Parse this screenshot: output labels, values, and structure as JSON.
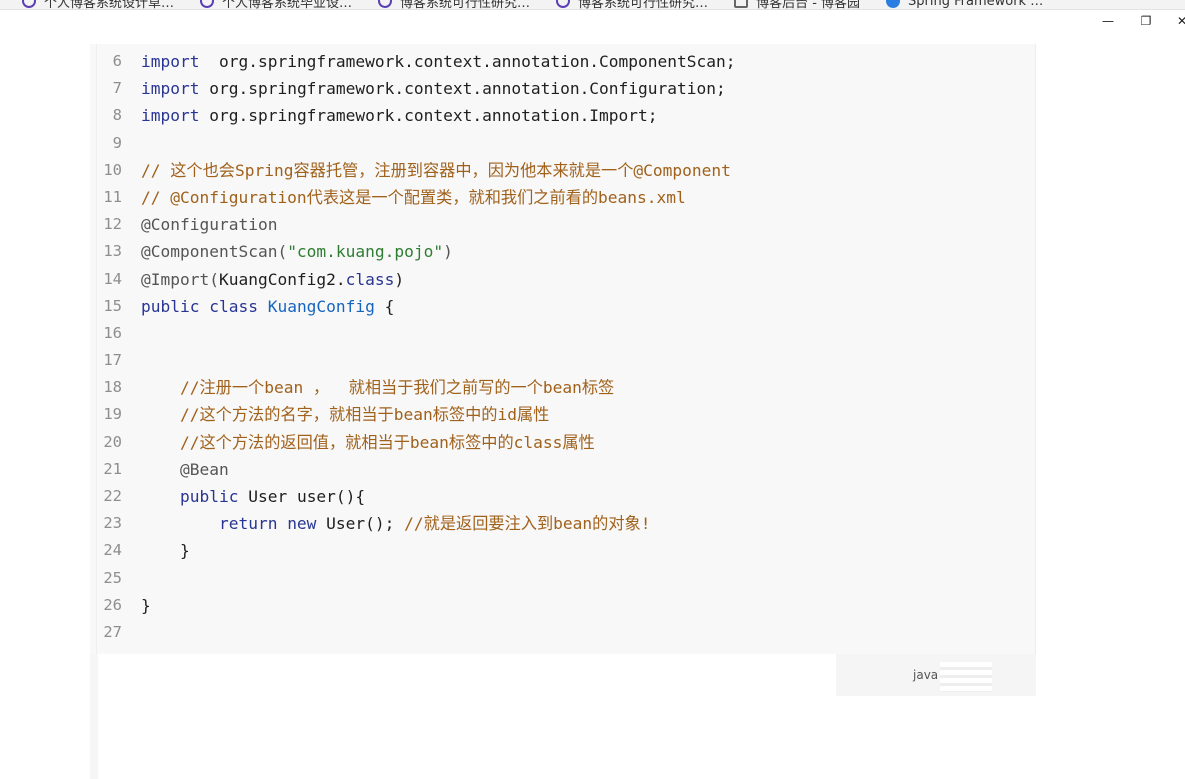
{
  "bookmarks": [
    {
      "label": "个人博客系统设计草…",
      "icon": "shield-icon"
    },
    {
      "label": "个人博客系统毕业设…",
      "icon": "shield-icon"
    },
    {
      "label": "博客系统可行性研究…",
      "icon": "shield-icon"
    },
    {
      "label": "博客系统可行性研究…",
      "icon": "shield-icon"
    },
    {
      "label": "博客后台 - 博客园",
      "icon": "document-icon"
    },
    {
      "label": "Spring Framework …",
      "icon": "spring-icon"
    }
  ],
  "window": {
    "minimize": "—",
    "restore": "❐",
    "close": "✕"
  },
  "code": {
    "language": "java",
    "lines": [
      {
        "n": "6",
        "parts": [
          [
            "kw",
            "import"
          ],
          [
            "",
            "  org.springframework.context.annotation.ComponentScan;"
          ]
        ]
      },
      {
        "n": "7",
        "parts": [
          [
            "kw",
            "import"
          ],
          [
            "",
            " org.springframework.context.annotation.Configuration;"
          ]
        ]
      },
      {
        "n": "8",
        "parts": [
          [
            "kw",
            "import"
          ],
          [
            "",
            " org.springframework.context.annotation.Import;"
          ]
        ]
      },
      {
        "n": "9",
        "parts": []
      },
      {
        "n": "10",
        "parts": [
          [
            "cm",
            "// 这个也会Spring容器托管，注册到容器中，因为他本来就是一个@Component"
          ]
        ]
      },
      {
        "n": "11",
        "parts": [
          [
            "cm",
            "// @Configuration代表这是一个配置类，就和我们之前看的beans.xml"
          ]
        ]
      },
      {
        "n": "12",
        "parts": [
          [
            "ann",
            "@Configuration"
          ]
        ]
      },
      {
        "n": "13",
        "parts": [
          [
            "ann",
            "@ComponentScan("
          ],
          [
            "str",
            "\"com.kuang.pojo\""
          ],
          [
            "ann",
            ")"
          ]
        ]
      },
      {
        "n": "14",
        "parts": [
          [
            "ann",
            "@Import("
          ],
          [
            "",
            "KuangConfig2."
          ],
          [
            "kw",
            "class"
          ],
          [
            "",
            ")"
          ]
        ]
      },
      {
        "n": "15",
        "parts": [
          [
            "kw",
            "public class "
          ],
          [
            "cls",
            "KuangConfig"
          ],
          [
            "",
            " {"
          ]
        ]
      },
      {
        "n": "16",
        "parts": []
      },
      {
        "n": "17",
        "parts": []
      },
      {
        "n": "18",
        "parts": [
          [
            "",
            "    "
          ],
          [
            "cm",
            "//注册一个bean ，  就相当于我们之前写的一个bean标签"
          ]
        ]
      },
      {
        "n": "19",
        "parts": [
          [
            "",
            "    "
          ],
          [
            "cm",
            "//这个方法的名字，就相当于bean标签中的id属性"
          ]
        ]
      },
      {
        "n": "20",
        "parts": [
          [
            "",
            "    "
          ],
          [
            "cm",
            "//这个方法的返回值，就相当于bean标签中的class属性"
          ]
        ]
      },
      {
        "n": "21",
        "parts": [
          [
            "",
            "    "
          ],
          [
            "ann",
            "@Bean"
          ]
        ]
      },
      {
        "n": "22",
        "parts": [
          [
            "",
            "    "
          ],
          [
            "kw",
            "public"
          ],
          [
            "",
            " User user(){"
          ]
        ]
      },
      {
        "n": "23",
        "parts": [
          [
            "",
            "        "
          ],
          [
            "kw",
            "return new"
          ],
          [
            "",
            " User(); "
          ],
          [
            "cm",
            "//就是返回要注入到bean的对象!"
          ]
        ]
      },
      {
        "n": "24",
        "parts": [
          [
            "",
            "    }"
          ]
        ]
      },
      {
        "n": "25",
        "parts": []
      },
      {
        "n": "26",
        "parts": [
          [
            "",
            "}"
          ]
        ]
      },
      {
        "n": "27",
        "parts": []
      }
    ]
  },
  "footer": {
    "language_label": "java"
  }
}
